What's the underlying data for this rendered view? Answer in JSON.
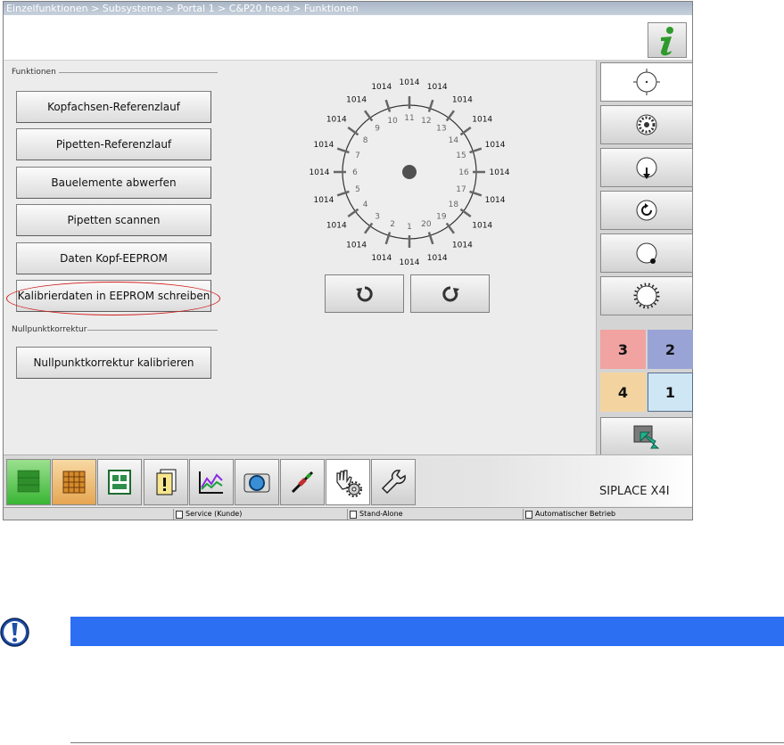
{
  "breadcrumb": "Einzelfunktionen > Subsysteme > Portal 1 > C&P20 head > Funktionen",
  "groups": {
    "functions_label": "Funktionen",
    "zero_label": "Nullpunktkorrektur"
  },
  "function_buttons": [
    "Kopfachsen-Referenzlauf",
    "Pipetten-Referenzlauf",
    "Bauelemente abwerfen",
    "Pipetten scannen",
    "Daten Kopf-EEPROM",
    "Kalibrierdaten in EEPROM schreiben"
  ],
  "zero_button": "Nullpunktkorrektur kalibrieren",
  "dial": {
    "value_label": "1014",
    "segments": [
      "1",
      "2",
      "3",
      "4",
      "5",
      "6",
      "7",
      "8",
      "9",
      "10",
      "11",
      "12",
      "13",
      "14",
      "15",
      "16",
      "17",
      "18",
      "19",
      "20"
    ]
  },
  "portals": [
    "3",
    "2",
    "4",
    "1"
  ],
  "colors": {
    "portal3": "#f0a3a0",
    "portal2": "#9aa3d6",
    "portal4": "#f3d4a0",
    "portal1": "#cfe6f5",
    "notice_bar": "#2d6ff2",
    "highlight": "#d01c1c"
  },
  "machine_name": "SIPLACE X4I",
  "status": {
    "user": "Service (Kunde)",
    "line_mode": "Stand-Alone",
    "operation": "Automatischer Betrieb"
  },
  "icons": {
    "info": "info-icon",
    "rotate_ccw": "rotate-ccw-icon",
    "rotate_cw": "rotate-cw-icon",
    "notice": "exclamation-icon"
  }
}
